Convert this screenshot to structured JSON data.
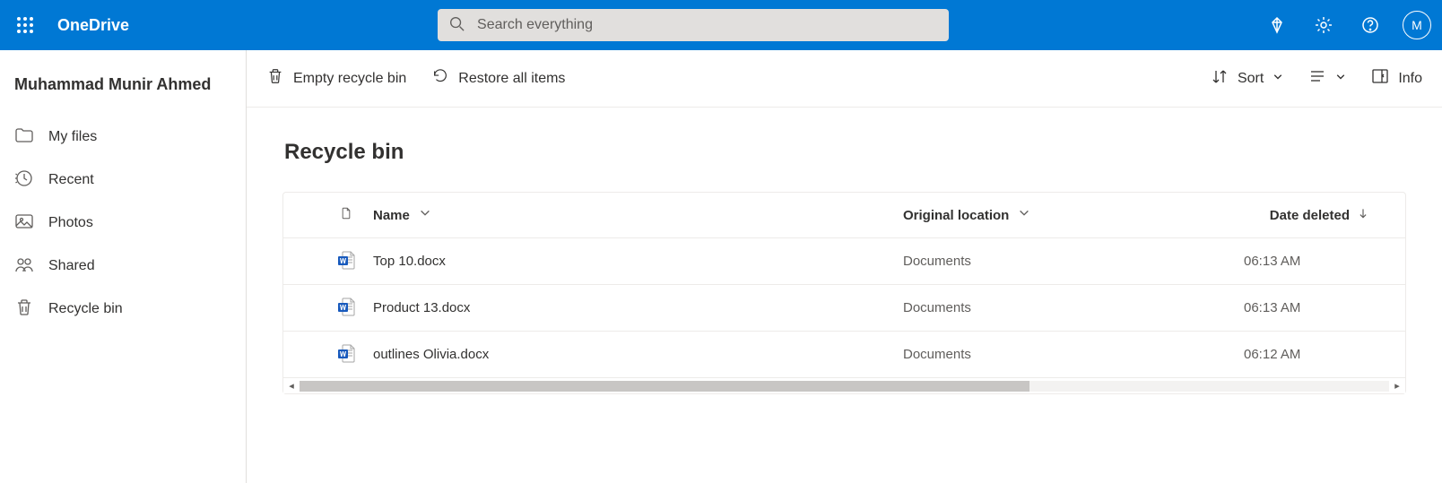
{
  "header": {
    "brand": "OneDrive",
    "search_placeholder": "Search everything",
    "avatar_initial": "M"
  },
  "sidebar": {
    "user_name": "Muhammad Munir Ahmed",
    "items": [
      {
        "label": "My files"
      },
      {
        "label": "Recent"
      },
      {
        "label": "Photos"
      },
      {
        "label": "Shared"
      },
      {
        "label": "Recycle bin"
      }
    ]
  },
  "commands": {
    "empty": "Empty recycle bin",
    "restore": "Restore all items",
    "sort": "Sort",
    "info": "Info"
  },
  "page": {
    "title": "Recycle bin"
  },
  "table": {
    "cols": {
      "name": "Name",
      "location": "Original location",
      "deleted": "Date deleted"
    },
    "rows": [
      {
        "name": "Top 10.docx",
        "location": "Documents",
        "deleted": "06:13 AM"
      },
      {
        "name": "Product 13.docx",
        "location": "Documents",
        "deleted": "06:13 AM"
      },
      {
        "name": "outlines Olivia.docx",
        "location": "Documents",
        "deleted": "06:12 AM"
      }
    ]
  }
}
